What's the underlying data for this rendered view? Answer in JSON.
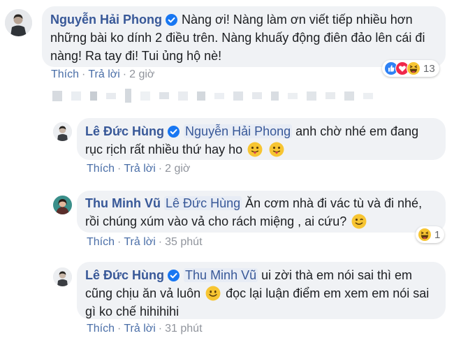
{
  "comments": [
    {
      "author": "Nguyễn Hải Phong",
      "text": "Nàng ơi! Nàng làm ơn viết tiếp nhiều hơn những bài ko dính 2 điều trên. Nàng khuấy động điên đảo lên cái đi nàng! Ra tay đi! Tui ủng hộ nè!",
      "like_label": "Thích",
      "reply_label": "Trả lời",
      "time": "2 giờ",
      "reaction_count": "13",
      "reaction_icons": [
        "like-icon",
        "love-icon",
        "haha-icon"
      ]
    }
  ],
  "replies": [
    {
      "author": "Lê Đức Hùng",
      "mention": "Nguyễn Hải Phong",
      "text": "anh chờ nhé em đang rục rịch rất nhiều thứ hay ho",
      "emojis": [
        "tongue-emoji",
        "tongue-emoji"
      ],
      "like_label": "Thích",
      "reply_label": "Trả lời",
      "time": "2 giờ"
    },
    {
      "author": "Thu Minh Vũ",
      "mention": "Lê Đức Hùng",
      "text": "Ăn cơm nhà đi vác tù và đi nhé, rồi chúng xúm vào vả cho rách miệng , ai cứu?",
      "emojis": [
        "wink-emoji"
      ],
      "like_label": "Thích",
      "reply_label": "Trả lời",
      "time": "35 phút",
      "reaction_count": "1",
      "reaction_icons": [
        "haha-icon"
      ]
    },
    {
      "author": "Lê Đức Hùng",
      "mention": "Thu Minh Vũ",
      "text": "ui zời thà em nói sai thì em cũng chịu ăn vả luôn",
      "text_after": "đọc lại luận điểm em xem em nói sai gì ko chế hihihihi",
      "emojis": [
        "smile-emoji"
      ],
      "like_label": "Thích",
      "reply_label": "Trả lời",
      "time": "31 phút"
    }
  ],
  "colors": {
    "link": "#385898",
    "bubble": "#f0f2f5",
    "meta": "#90949c",
    "verified": "#1877f2"
  }
}
